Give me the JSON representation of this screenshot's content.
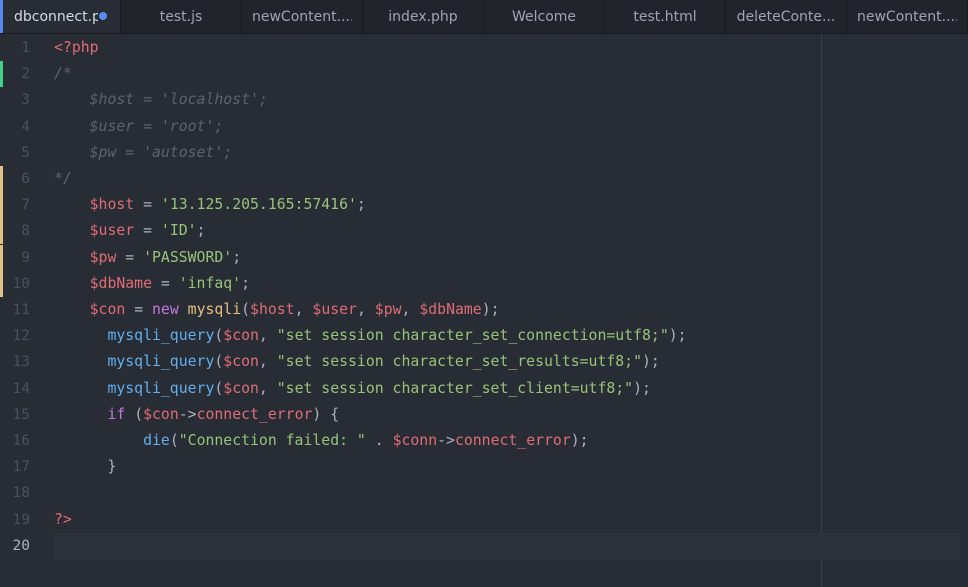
{
  "tabs": [
    {
      "label": "dbconnect.php",
      "active": true,
      "modified": true
    },
    {
      "label": "test.js",
      "active": false
    },
    {
      "label": "newContent....",
      "active": false
    },
    {
      "label": "index.php",
      "active": false
    },
    {
      "label": "Welcome",
      "active": false
    },
    {
      "label": "test.html",
      "active": false
    },
    {
      "label": "deleteConte...",
      "active": false
    },
    {
      "label": "newContent....",
      "active": false
    }
  ],
  "gutter": {
    "line_numbers": [
      "1",
      "2",
      "3",
      "4",
      "5",
      "6",
      "7",
      "8",
      "9",
      "10",
      "11",
      "12",
      "13",
      "14",
      "15",
      "16",
      "17",
      "18",
      "19",
      "20"
    ],
    "current_line": "20",
    "git_markers": [
      {
        "line": 2,
        "type": "added"
      },
      {
        "line": 6,
        "type": "modified"
      },
      {
        "line": 7,
        "type": "modified"
      },
      {
        "line": 8,
        "type": "modified"
      },
      {
        "line": 9,
        "type": "modified"
      },
      {
        "line": 10,
        "type": "modified"
      }
    ]
  },
  "code": {
    "lines": [
      [
        {
          "t": "<?php",
          "c": "tag"
        }
      ],
      [
        {
          "t": "/*",
          "c": "c"
        }
      ],
      [
        {
          "t": "    $host = 'localhost';",
          "c": "c"
        }
      ],
      [
        {
          "t": "    $user = 'root';",
          "c": "c"
        }
      ],
      [
        {
          "t": "    $pw = 'autoset';",
          "c": "c"
        }
      ],
      [
        {
          "t": "*/",
          "c": "c"
        }
      ],
      [
        {
          "t": "    ",
          "c": "p"
        },
        {
          "t": "$host",
          "c": "v"
        },
        {
          "t": " = ",
          "c": "p"
        },
        {
          "t": "'13.125.205.165:57416'",
          "c": "s"
        },
        {
          "t": ";",
          "c": "p"
        }
      ],
      [
        {
          "t": "    ",
          "c": "p"
        },
        {
          "t": "$user",
          "c": "v"
        },
        {
          "t": " = ",
          "c": "p"
        },
        {
          "t": "'ID'",
          "c": "s"
        },
        {
          "t": ";",
          "c": "p"
        }
      ],
      [
        {
          "t": "    ",
          "c": "p"
        },
        {
          "t": "$pw",
          "c": "v"
        },
        {
          "t": " = ",
          "c": "p"
        },
        {
          "t": "'PASSWORD'",
          "c": "s"
        },
        {
          "t": ";",
          "c": "p"
        }
      ],
      [
        {
          "t": "    ",
          "c": "p"
        },
        {
          "t": "$dbName",
          "c": "v"
        },
        {
          "t": " = ",
          "c": "p"
        },
        {
          "t": "'infaq'",
          "c": "s"
        },
        {
          "t": ";",
          "c": "p"
        }
      ],
      [
        {
          "t": "    ",
          "c": "p"
        },
        {
          "t": "$con",
          "c": "v"
        },
        {
          "t": " = ",
          "c": "p"
        },
        {
          "t": "new",
          "c": "k"
        },
        {
          "t": " ",
          "c": "p"
        },
        {
          "t": "mysqli",
          "c": "cls"
        },
        {
          "t": "(",
          "c": "p"
        },
        {
          "t": "$host",
          "c": "v"
        },
        {
          "t": ", ",
          "c": "p"
        },
        {
          "t": "$user",
          "c": "v"
        },
        {
          "t": ", ",
          "c": "p"
        },
        {
          "t": "$pw",
          "c": "v"
        },
        {
          "t": ", ",
          "c": "p"
        },
        {
          "t": "$dbName",
          "c": "v"
        },
        {
          "t": ");",
          "c": "p"
        }
      ],
      [
        {
          "t": "      ",
          "c": "p"
        },
        {
          "t": "mysqli_query",
          "c": "f"
        },
        {
          "t": "(",
          "c": "p"
        },
        {
          "t": "$con",
          "c": "v"
        },
        {
          "t": ", ",
          "c": "p"
        },
        {
          "t": "\"set session character_set_connection=utf8;\"",
          "c": "s"
        },
        {
          "t": ");",
          "c": "p"
        }
      ],
      [
        {
          "t": "      ",
          "c": "p"
        },
        {
          "t": "mysqli_query",
          "c": "f"
        },
        {
          "t": "(",
          "c": "p"
        },
        {
          "t": "$con",
          "c": "v"
        },
        {
          "t": ", ",
          "c": "p"
        },
        {
          "t": "\"set session character_set_results=utf8;\"",
          "c": "s"
        },
        {
          "t": ");",
          "c": "p"
        }
      ],
      [
        {
          "t": "      ",
          "c": "p"
        },
        {
          "t": "mysqli_query",
          "c": "f"
        },
        {
          "t": "(",
          "c": "p"
        },
        {
          "t": "$con",
          "c": "v"
        },
        {
          "t": ", ",
          "c": "p"
        },
        {
          "t": "\"set session character_set_client=utf8;\"",
          "c": "s"
        },
        {
          "t": ");",
          "c": "p"
        }
      ],
      [
        {
          "t": "      ",
          "c": "p"
        },
        {
          "t": "if",
          "c": "k"
        },
        {
          "t": " (",
          "c": "p"
        },
        {
          "t": "$con",
          "c": "v"
        },
        {
          "t": "->",
          "c": "p"
        },
        {
          "t": "connect_error",
          "c": "prop"
        },
        {
          "t": ") {",
          "c": "p"
        }
      ],
      [
        {
          "t": "          ",
          "c": "p"
        },
        {
          "t": "die",
          "c": "f"
        },
        {
          "t": "(",
          "c": "p"
        },
        {
          "t": "\"Connection failed: \"",
          "c": "s"
        },
        {
          "t": " . ",
          "c": "p"
        },
        {
          "t": "$conn",
          "c": "v"
        },
        {
          "t": "->",
          "c": "p"
        },
        {
          "t": "connect_error",
          "c": "prop"
        },
        {
          "t": ");",
          "c": "p"
        }
      ],
      [
        {
          "t": "      }",
          "c": "p"
        }
      ],
      [
        {
          "t": "",
          "c": "p"
        }
      ],
      [
        {
          "t": "?>",
          "c": "tag"
        }
      ],
      [
        {
          "t": "",
          "c": "p"
        }
      ]
    ]
  },
  "colors": {
    "background": "#282c34",
    "tab_bar": "#21252b",
    "accent": "#568af2",
    "git_added": "#43d08a",
    "git_modified": "#e0c285"
  }
}
